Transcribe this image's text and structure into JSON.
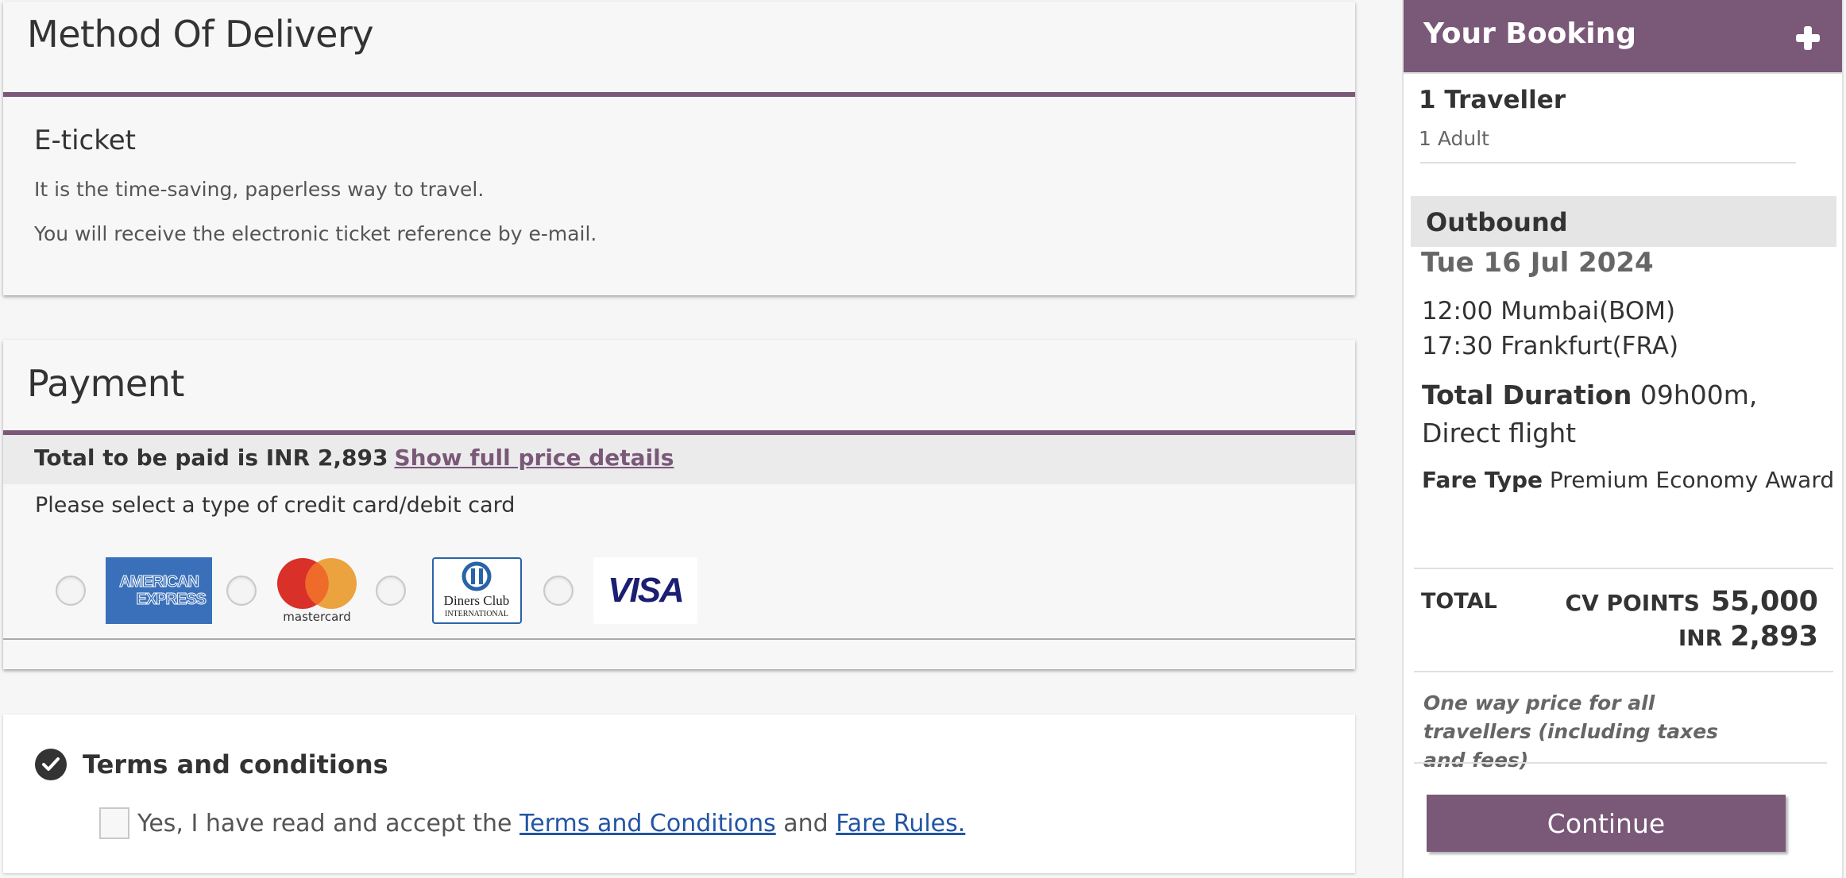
{
  "delivery": {
    "title": "Method Of Delivery",
    "option_title": "E-ticket",
    "lines": [
      "It is the time-saving, paperless way to travel.",
      "You will receive the electronic ticket reference by e-mail."
    ]
  },
  "payment": {
    "title": "Payment",
    "total_text": "Total to be paid is INR 2,893",
    "price_details_link": "Show full price details",
    "instruction": "Please select a type of credit card/debit card",
    "cards": [
      {
        "name": "American Express",
        "line1": "AMERICAN",
        "line2": "EXPRESS",
        "selected": false
      },
      {
        "name": "Mastercard",
        "label": "mastercard",
        "selected": false
      },
      {
        "name": "Diners Club International",
        "line1": "Diners Club",
        "line2": "INTERNATIONAL",
        "selected": false
      },
      {
        "name": "Visa",
        "label": "VISA",
        "selected": false
      }
    ]
  },
  "terms": {
    "title": "Terms and conditions",
    "accept_prefix": "Yes, I have read and accept the",
    "terms_link": "Terms and Conditions",
    "conjunction": "and",
    "fare_rules_link": "Fare Rules.",
    "checked": false
  },
  "booking": {
    "title": "Your Booking",
    "travellers": "1 Traveller",
    "passenger_breakdown": "1 Adult",
    "direction": "Outbound",
    "date": "Tue 16 Jul 2024",
    "departure": "12:00 Mumbai(BOM)",
    "arrival": "17:30 Frankfurt(FRA)",
    "duration_label": "Total Duration",
    "duration_value": "09h00m, Direct flight",
    "fare_type_label": "Fare Type",
    "fare_type_value": "Premium Economy Award",
    "total_label": "TOTAL",
    "points_currency": "CV POINTS",
    "points_value": "55,000",
    "cash_currency": "INR",
    "cash_value": "2,893",
    "note": "One way price for all travellers (including taxes and fees)",
    "continue_label": "Continue"
  },
  "colors": {
    "brand": "#7a5878",
    "link_blue": "#2255a4"
  }
}
